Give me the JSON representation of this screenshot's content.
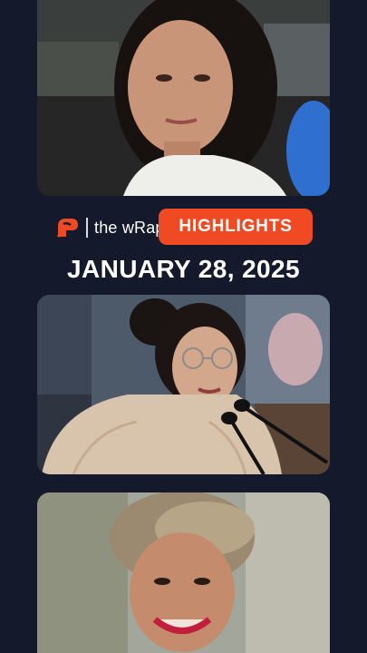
{
  "brand": {
    "logo_icon": "rappler-logo-icon",
    "show_name": "the wRap",
    "badge": "HIGHLIGHTS",
    "accent": "#ef4a24"
  },
  "episode": {
    "date": "JANUARY 28, 2025"
  },
  "colors": {
    "background": "#141a2b",
    "text": "#ffffff"
  }
}
